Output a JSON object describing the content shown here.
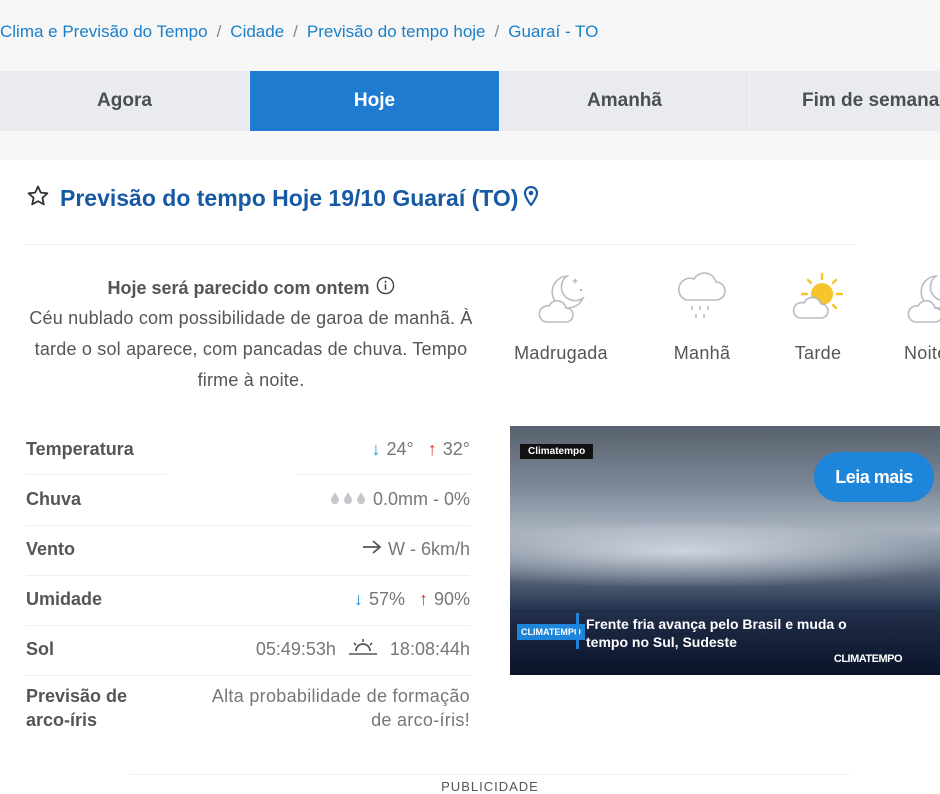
{
  "breadcrumb": [
    "Clima e Previsão do Tempo",
    "Cidade",
    "Previsão do tempo hoje",
    "Guaraí - TO"
  ],
  "tabs": [
    "Agora",
    "Hoje",
    "Amanhã",
    "Fim de semana"
  ],
  "active_tab": "Hoje",
  "title": "Previsão do tempo Hoje 19/10 Guaraí (TO)",
  "summary": {
    "heading": "Hoje será parecido com ontem",
    "text": "Céu nublado com possibilidade de garoa de manhã. À tarde o sol aparece, com pancadas de chuva. Tempo firme à noite."
  },
  "periods": [
    {
      "label": "Madrugada",
      "icon": "moon-cloud-icon"
    },
    {
      "label": "Manhã",
      "icon": "cloud-drizzle-icon"
    },
    {
      "label": "Tarde",
      "icon": "sun-cloud-icon"
    },
    {
      "label": "Noite",
      "icon": "moon-cloud-icon"
    }
  ],
  "details": {
    "temperatura": {
      "label": "Temperatura",
      "min": "24°",
      "max": "32°"
    },
    "chuva": {
      "label": "Chuva",
      "value": "0.0mm - 0%"
    },
    "vento": {
      "label": "Vento",
      "value": "W - 6km/h"
    },
    "umidade": {
      "label": "Umidade",
      "min": "57%",
      "max": "90%"
    },
    "sol": {
      "label": "Sol",
      "sunrise": "05:49:53h",
      "sunset": "18:08:44h"
    },
    "arco_iris": {
      "label_1": "Previsão de",
      "label_2": "arco-íris",
      "value_1": "Alta probabilidade de formação",
      "value_2": "de arco-íris!"
    }
  },
  "video": {
    "tag": "Climatempo",
    "button": "Leia mais",
    "logo": "CLIMATEMPO",
    "caption": "Frente fria avança pelo Brasil e muda o tempo no Sul, Sudeste",
    "brand": "CLIMATEMPO"
  },
  "publicidade": "PUBLICIDADE",
  "colors": {
    "primary": "#1f7bd0",
    "title": "#175aa3",
    "down": "#1d8fe0",
    "up": "#e0312e"
  }
}
